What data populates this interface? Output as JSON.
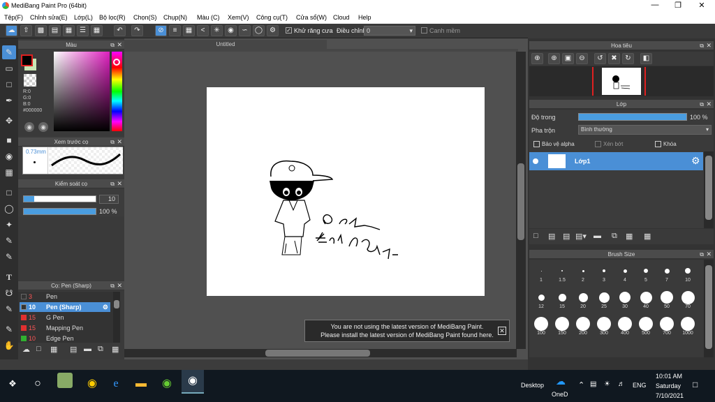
{
  "app": {
    "title": "MediBang Paint Pro (64bit)"
  },
  "menu": [
    "Tệp(F)",
    "Chỉnh sửa(E)",
    "Lớp(L)",
    "Bộ lọc(R)",
    "Chọn(S)",
    "Chụp(N)",
    "Màu (C)",
    "Xem(V)",
    "Công cụ(T)",
    "Cửa sổ(W)",
    "Cloud",
    "Help"
  ],
  "toolbar": {
    "antialias": "Khử răng cưa",
    "correction_label": "Điều chỉnh",
    "correction_value": "0",
    "edge": "Canh mềm"
  },
  "color_panel": {
    "title": "Màu",
    "r": "R:0",
    "g": "G:0",
    "b": "B:0",
    "hex": "#000000",
    "fg": "#000000",
    "bg": "#c8e6b4"
  },
  "brush_preview": {
    "title": "Xem trước cọ",
    "size": "0.73mm"
  },
  "brush_control": {
    "title": "Kiểm soát cọ",
    "size_value": "10",
    "opacity_value": "100 %",
    "size_fraction": 0.15,
    "opacity_fraction": 1.0
  },
  "brush_list": {
    "title": "Cọ: Pen (Sharp)",
    "items": [
      {
        "num": "3",
        "name": "Pen",
        "color": "#333333"
      },
      {
        "num": "10",
        "name": "Pen (Sharp)",
        "color": "#333333"
      },
      {
        "num": "15",
        "name": "G Pen",
        "color": "#e03030"
      },
      {
        "num": "15",
        "name": "Mapping Pen",
        "color": "#e03030"
      },
      {
        "num": "10",
        "name": "Edge Pen",
        "color": "#30b030"
      }
    ]
  },
  "canvas": {
    "tab": "Untitled",
    "notice_line1": "You are not using the latest version of MediBang Paint.",
    "notice_line2": "Please install the latest version of MediBang Paint found here."
  },
  "navigator": {
    "title": "Hoa tiêu"
  },
  "layer_panel": {
    "title": "Lớp",
    "opacity_label": "Độ trong",
    "opacity_value": "100 %",
    "opacity_fraction": 1.0,
    "blend_label": "Pha trộn",
    "blend_value": "Bình thường",
    "protect_alpha": "Bảo vệ alpha",
    "clipping": "Xén bớt",
    "lock": "Khóa",
    "layer_name": "Lớp1"
  },
  "brush_size": {
    "title": "Brush Size",
    "sizes": [
      "1",
      "1.5",
      "2",
      "3",
      "4",
      "5",
      "7",
      "10",
      "12",
      "15",
      "20",
      "25",
      "30",
      "40",
      "50",
      "70",
      "100",
      "150",
      "200",
      "300",
      "400",
      "500",
      "700",
      "1000"
    ]
  },
  "taskbar": {
    "desktop": "Desktop",
    "onedrive": "OneD",
    "lang": "ENG",
    "time": "10:01 AM",
    "day": "Saturday",
    "date": "7/10/2021"
  }
}
